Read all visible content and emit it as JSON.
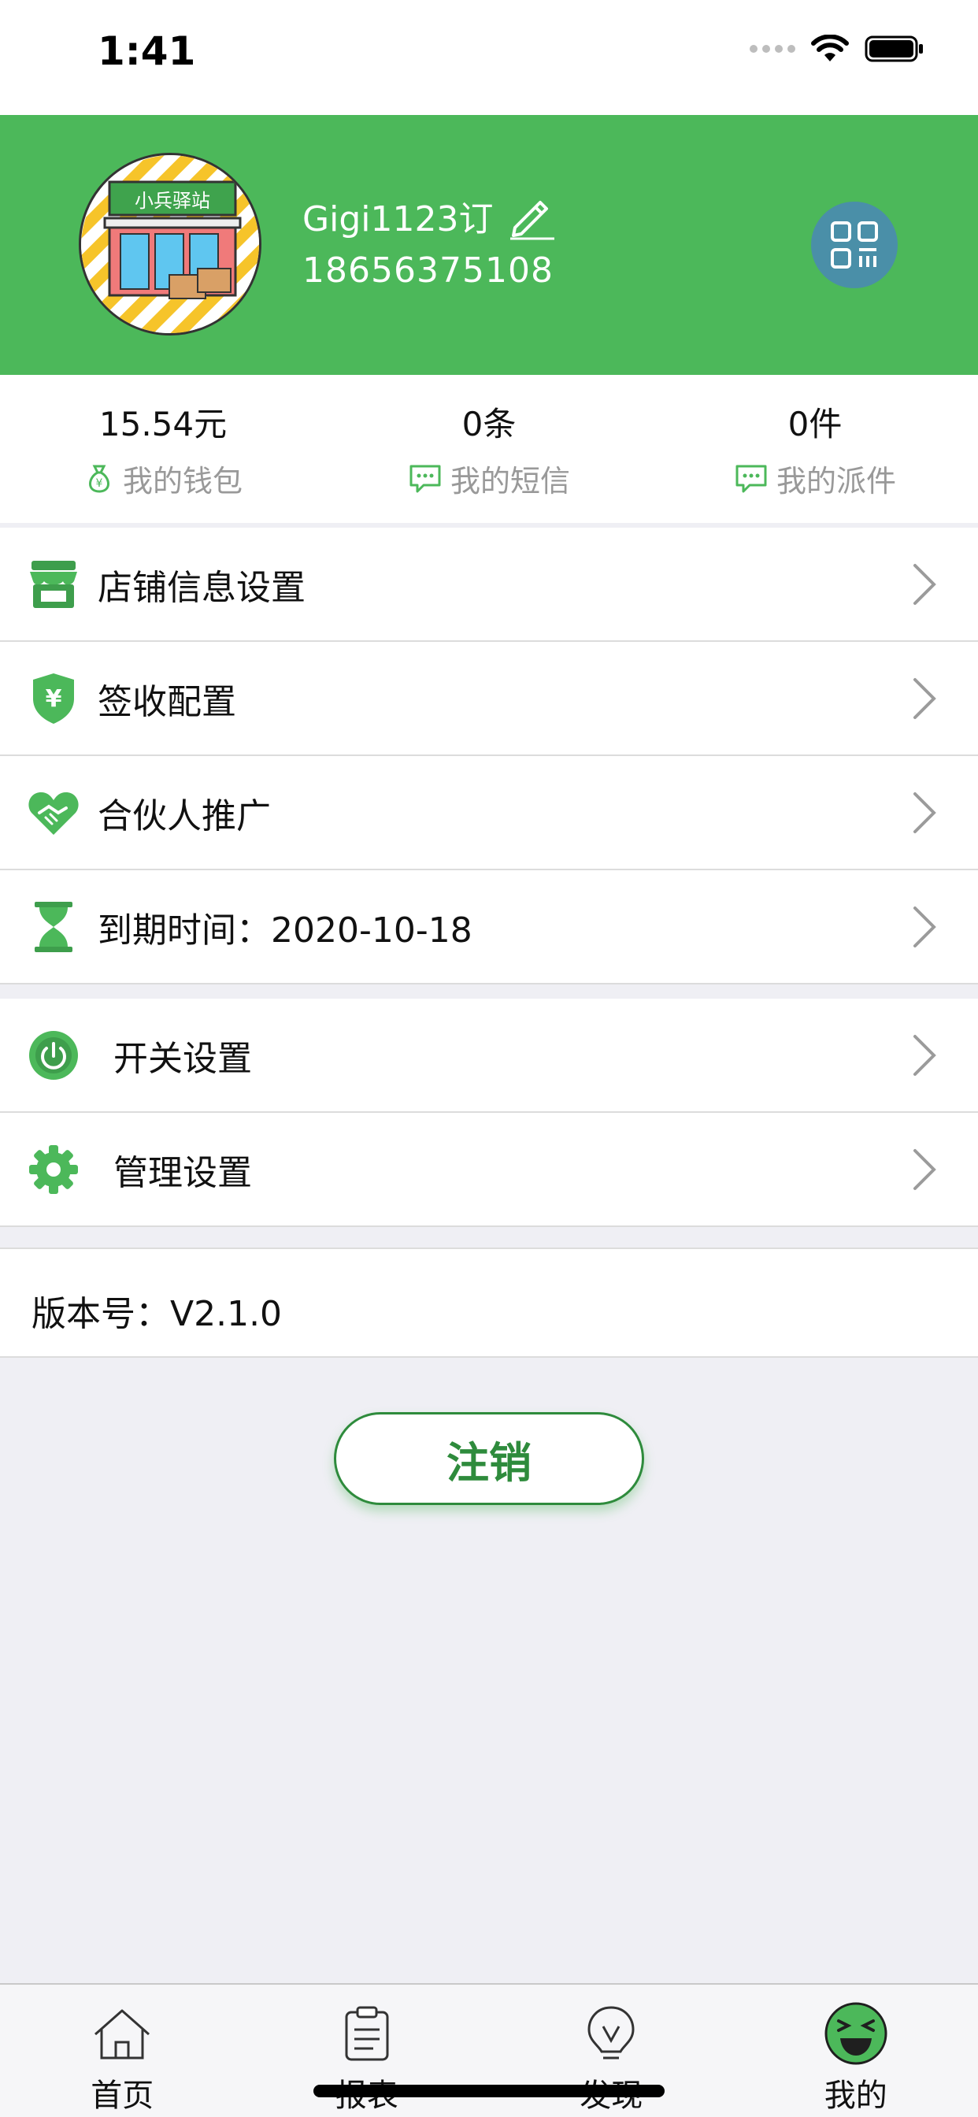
{
  "status_bar": {
    "time": "1:41",
    "icons": [
      "signal-icon",
      "wifi-icon",
      "battery-icon"
    ]
  },
  "profile": {
    "avatar_label": "小兵驿站",
    "name": "Gigi1123订",
    "phone": "18656375108",
    "colors": {
      "header_bg": "#4CB85A",
      "qr_bg": "#4A8FA8"
    }
  },
  "stats": [
    {
      "value": "15.54元",
      "label": "我的钱包",
      "icon": "wallet-icon"
    },
    {
      "value": "0条",
      "label": "我的短信",
      "icon": "message-icon"
    },
    {
      "value": "0件",
      "label": "我的派件",
      "icon": "message-icon"
    }
  ],
  "menu_group_1": [
    {
      "label": "店铺信息设置",
      "icon": "store-icon"
    },
    {
      "label": "签收配置",
      "icon": "shield-yen-icon"
    },
    {
      "label": "合伙人推广",
      "icon": "handshake-icon"
    },
    {
      "label": "到期时间：2020-10-18",
      "icon": "hourglass-icon"
    }
  ],
  "menu_group_2": [
    {
      "label": "开关设置",
      "icon": "power-icon"
    },
    {
      "label": "管理设置",
      "icon": "gear-icon"
    }
  ],
  "version": "版本号：V2.1.0",
  "logout_label": "注销",
  "tabs": [
    {
      "label": "首页",
      "icon": "home-icon",
      "active": false
    },
    {
      "label": "报表",
      "icon": "clipboard-icon",
      "active": false
    },
    {
      "label": "发现",
      "icon": "bulb-icon",
      "active": false
    },
    {
      "label": "我的",
      "icon": "smiley-icon",
      "active": true
    }
  ],
  "accent_color": "#4CB85A"
}
